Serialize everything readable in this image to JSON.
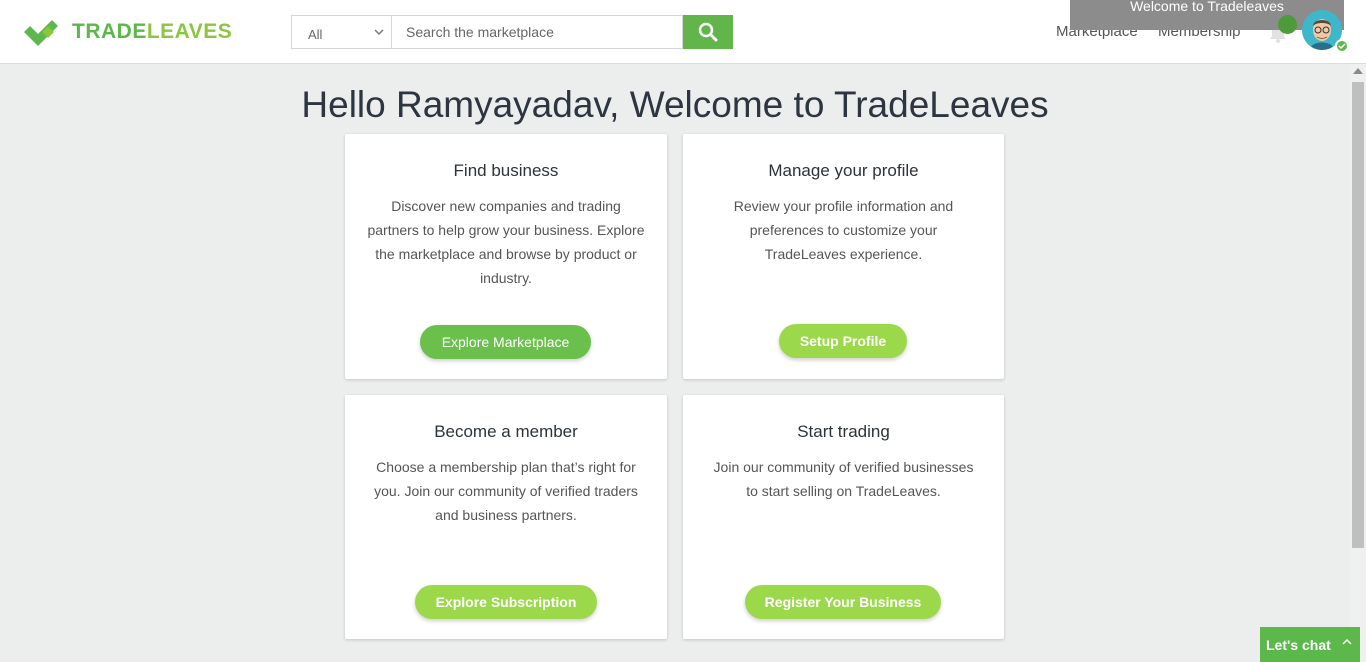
{
  "header": {
    "logo": {
      "part1": "TRADE",
      "part2": "LEAVES"
    },
    "search": {
      "category": "All",
      "placeholder": "Search the marketplace"
    },
    "nav": {
      "marketplace": "Marketplace",
      "membership": "Membership"
    },
    "toast": "Welcome to Tradeleaves"
  },
  "main": {
    "greeting": "Hello Ramyayadav, Welcome to TradeLeaves",
    "cards": [
      {
        "title": "Find business",
        "description": "Discover new companies and trading partners to help grow your business. Explore the marketplace and browse by product or industry.",
        "button": "Explore Marketplace"
      },
      {
        "title": "Manage your profile",
        "description": "Review your profile information and preferences to customize your TradeLeaves experience.",
        "button": "Setup Profile"
      },
      {
        "title": "Become a member",
        "description": "Choose a membership plan that’s right for you. Join our community of verified traders and business partners.",
        "button": "Explore Subscription"
      },
      {
        "title": "Start trading",
        "description": "Join our community of verified businesses to start selling on TradeLeaves.",
        "button": "Register Your Business"
      }
    ]
  },
  "chat": {
    "label": "Let's chat"
  },
  "colors": {
    "brand_green": "#5cb84a",
    "light_green": "#9cd94a",
    "background": "#eceeee"
  },
  "icons": [
    "tradeleaves-logo-icon",
    "chevron-down-icon",
    "search-icon",
    "bell-icon",
    "avatar-icon",
    "check-icon",
    "chevron-up-icon"
  ]
}
